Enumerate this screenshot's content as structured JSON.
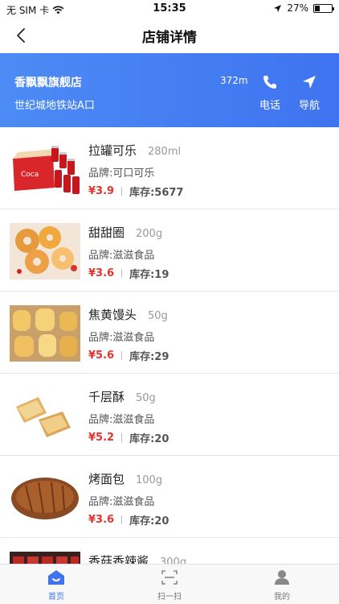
{
  "status_bar": {
    "carrier": "无 SIM 卡",
    "time": "15:35",
    "battery": "27%",
    "battery_level": 0.27
  },
  "header": {
    "title": "店铺详情"
  },
  "store": {
    "name": "香飘飘旗舰店",
    "address": "世纪城地铁站A口",
    "distance": "372m",
    "call_label": "电话",
    "navigate_label": "导航"
  },
  "products": [
    {
      "name": "拉罐可乐",
      "spec": "280ml",
      "brand": "品牌:可口可乐",
      "price": "¥3.9",
      "stock": "库存:5677",
      "image": "cola"
    },
    {
      "name": "甜甜圈",
      "spec": "200g",
      "brand": "品牌:滋滋食品",
      "price": "¥3.6",
      "stock": "库存:19",
      "image": "donut"
    },
    {
      "name": "焦黄馒头",
      "spec": "50g",
      "brand": "品牌:滋滋食品",
      "price": "¥5.6",
      "stock": "库存:29",
      "image": "bun"
    },
    {
      "name": "千层酥",
      "spec": "50g",
      "brand": "品牌:滋滋食品",
      "price": "¥5.2",
      "stock": "库存:20",
      "image": "pastry"
    },
    {
      "name": "烤面包",
      "spec": "100g",
      "brand": "品牌:滋滋食品",
      "price": "¥3.6",
      "stock": "库存:20",
      "image": "bread"
    },
    {
      "name": "香菇香辣酱",
      "spec": "300g",
      "brand": "",
      "price": "",
      "stock": "",
      "image": "sauce"
    }
  ],
  "tabbar": {
    "home": "首页",
    "scan": "扫一扫",
    "mine": "我的"
  },
  "colors": {
    "accent": "#3f73f0",
    "price": "#e5322d"
  }
}
